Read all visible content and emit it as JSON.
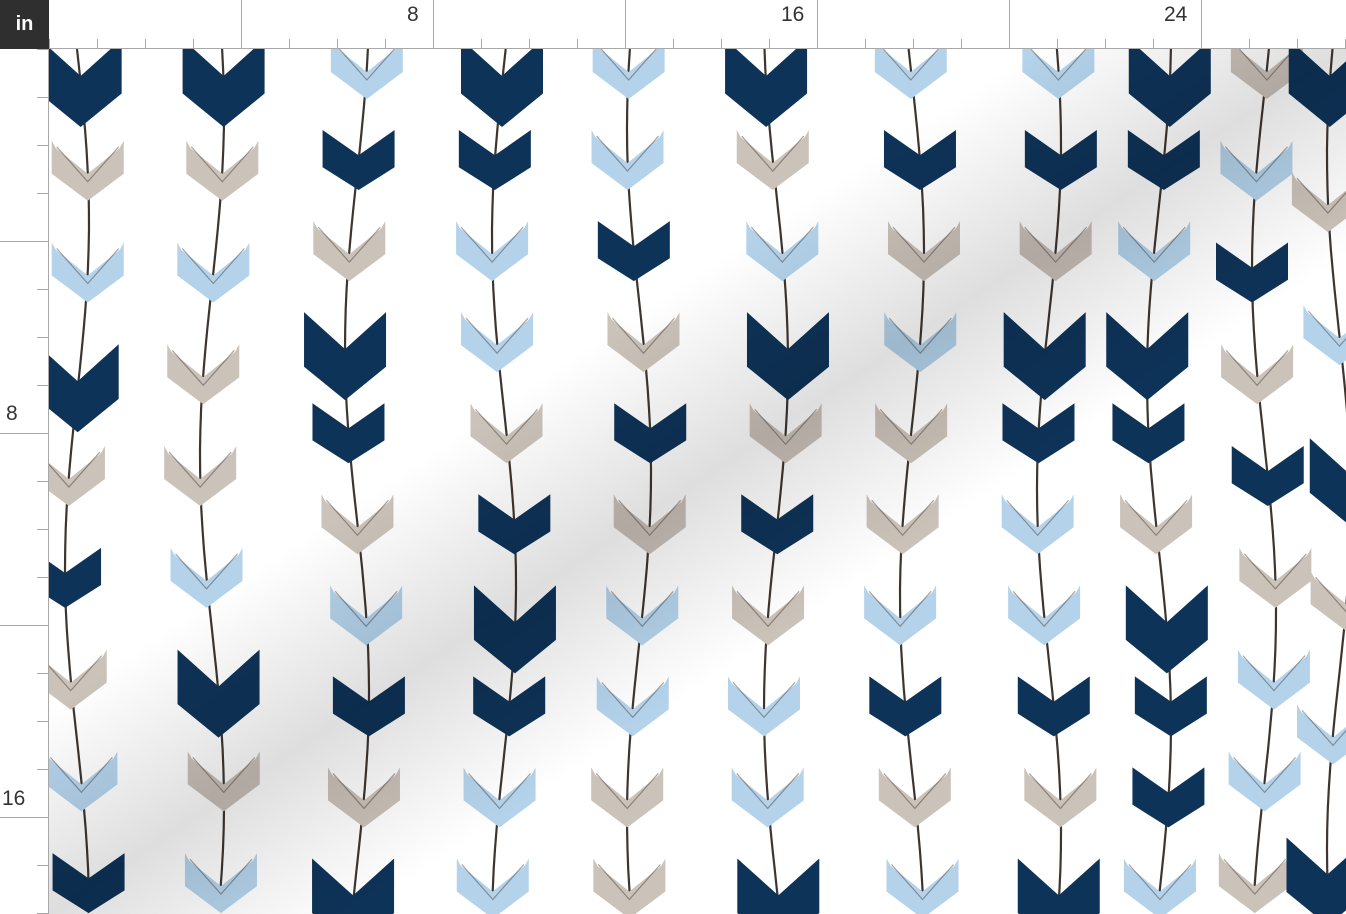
{
  "ruler": {
    "unit": "in",
    "top_labels": [
      "8",
      "16",
      "24"
    ],
    "left_labels": [
      "8",
      "16"
    ]
  },
  "fabric": {
    "pattern": "arrows",
    "colors": {
      "navy": "#0e3358",
      "light_blue": "#b4d3eb",
      "taupe": "#cbc2b9",
      "shaft": "#3d3530",
      "background": "#ffffff"
    }
  }
}
